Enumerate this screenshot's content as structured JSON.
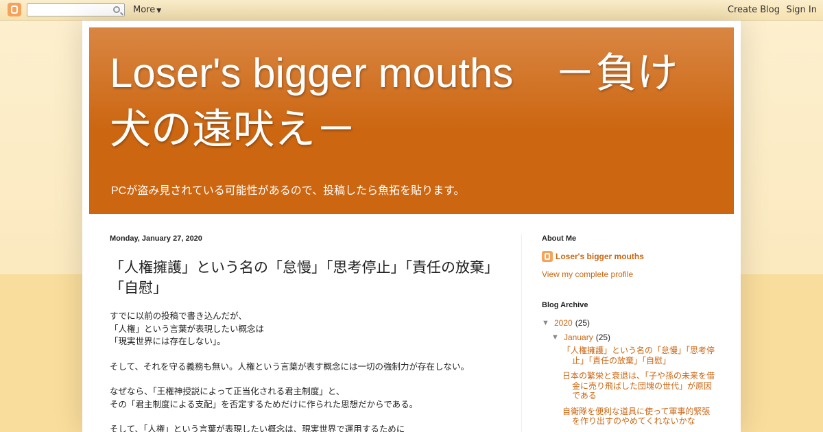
{
  "navbar": {
    "search_placeholder": "",
    "more_label": "More",
    "create_blog_label": "Create Blog",
    "sign_in_label": "Sign In"
  },
  "header": {
    "title": "Loser's bigger mouths　－負け犬の遠吠え－",
    "description": "PCが盗み見されている可能性があるので、投稿したら魚拓を貼ります。"
  },
  "post": {
    "date": "Monday, January 27, 2020",
    "title": "「人権擁護」という名の「怠慢」「思考停止」「責任の放棄」「自慰」",
    "body": [
      "すでに以前の投稿で書き込んだが、",
      "「人権」という言葉が表現したい概念は",
      "「現実世界には存在しない」。",
      "",
      "そして、それを守る義務も無い。人権という言葉が表す概念には一切の強制力が存在しない。",
      "",
      "なぜなら、「王権神授説によって正当化される君主制度」と、",
      "その「君主制度による支配」を否定するためだけに作られた思想だからである。",
      "",
      "そして、「人権」という言葉が表現したい概念は、現実世界で運用するために"
    ]
  },
  "sidebar": {
    "about_title": "About Me",
    "profile_name": "Loser's bigger mouths",
    "profile_link": "View my complete profile",
    "archive_title": "Blog Archive",
    "archive": {
      "year": "2020",
      "year_count": "(25)",
      "month": "January",
      "month_count": "(25)",
      "posts": [
        "「人権擁護」という名の「怠慢」「思考停止」「責任の放棄」「自慰」",
        "日本の繁栄と衰退は、「子や孫の未来を借金に売り飛ばした団塊の世代」が原因である",
        "自衛隊を便利な道具に使って軍事的緊張を作り出すのやめてくれないかな"
      ]
    }
  },
  "colors": {
    "accent": "#cc6611",
    "header_top": "#d98643",
    "background": "#f9dd9c"
  }
}
